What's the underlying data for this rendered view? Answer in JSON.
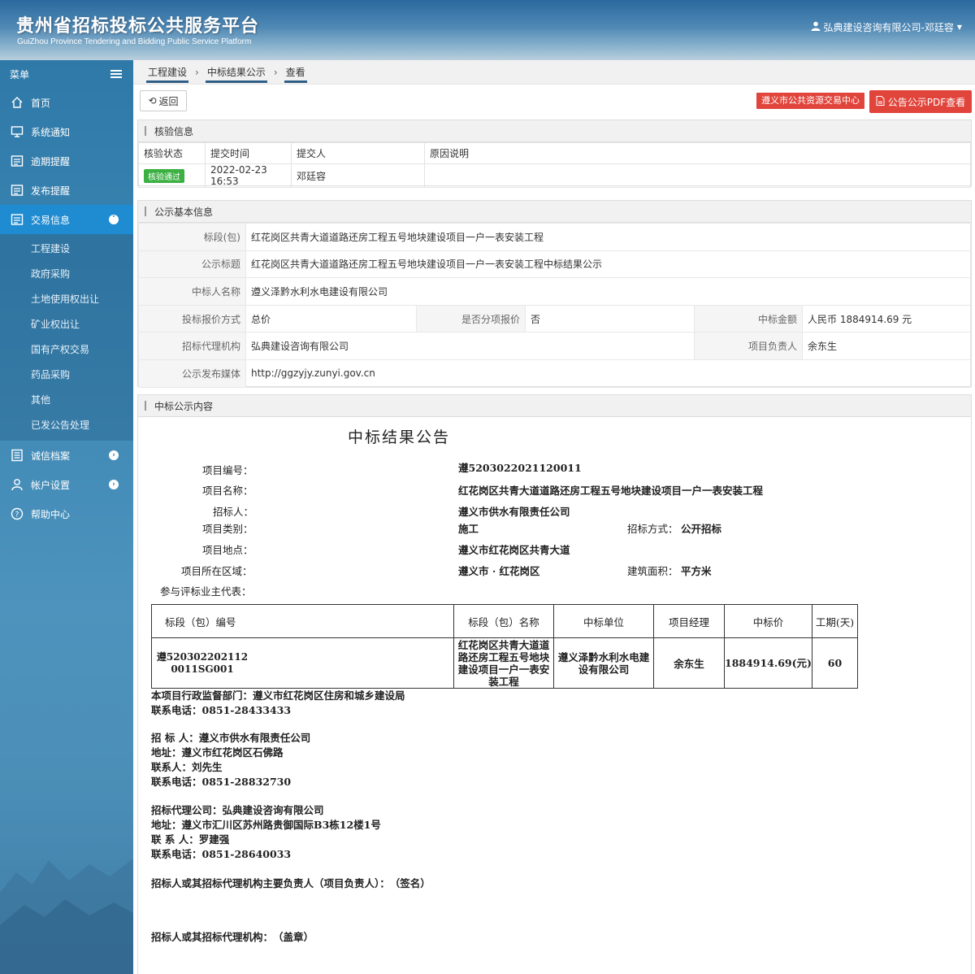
{
  "header": {
    "title": "贵州省招标投标公共服务平台",
    "subtitle": "GuiZhou Province Tendering and Bidding Public Service Platform",
    "user": "弘典建设咨询有限公司-邓廷容"
  },
  "sidebar": {
    "menu_label": "菜单",
    "items": [
      {
        "label": "首页",
        "icon": "home-icon"
      },
      {
        "label": "系统通知",
        "icon": "monitor-icon"
      },
      {
        "label": "逾期提醒",
        "icon": "list-icon"
      },
      {
        "label": "发布提醒",
        "icon": "list-icon"
      },
      {
        "label": "交易信息",
        "icon": "list-icon"
      }
    ],
    "sub_items": [
      "工程建设",
      "政府采购",
      "土地使用权出让",
      "矿业权出让",
      "国有产权交易",
      "药品采购",
      "其他",
      "已发公告处理"
    ],
    "bottom_items": [
      {
        "label": "诚信档案",
        "icon": "document-icon"
      },
      {
        "label": "帐户设置",
        "icon": "user-icon"
      },
      {
        "label": "帮助中心",
        "icon": "help-icon"
      }
    ]
  },
  "breadcrumb": [
    "工程建设",
    "中标结果公示",
    "查看"
  ],
  "toolbar": {
    "back": "返回",
    "center": "遵义市公共资源交易中心",
    "pdf": "公告公示PDF查看"
  },
  "verify": {
    "title": "核验信息",
    "headers": [
      "核验状态",
      "提交时间",
      "提交人",
      "原因说明"
    ],
    "row": {
      "status": "核验通过",
      "time": "2022-02-23 16:53",
      "person": "邓廷容",
      "reason": ""
    }
  },
  "basic": {
    "title": "公示基本信息",
    "section_label": "标段(包)",
    "section_value": "红花岗区共青大道道路还房工程五号地块建设项目一户一表安装工程",
    "notice_title_label": "公示标题",
    "notice_title_value": "红花岗区共青大道道路还房工程五号地块建设项目一户一表安装工程中标结果公示",
    "winner_label": "中标人名称",
    "winner_value": "遵义泽黔水利水电建设有限公司",
    "bid_method_label": "投标报价方式",
    "bid_method_value": "总价",
    "split_label": "是否分项报价",
    "split_value": "否",
    "amount_label": "中标金额",
    "amount_value": "人民币 1884914.69 元",
    "agency_label": "招标代理机构",
    "agency_value": "弘典建设咨询有限公司",
    "manager_label": "项目负责人",
    "manager_value": "余东生",
    "media_label": "公示发布媒体",
    "media_value": "http://ggzyjy.zunyi.gov.cn"
  },
  "content": {
    "title": "中标公示内容",
    "doc_title": "中标结果公告",
    "project_no_label": "项目编号：",
    "project_no": "遵5203022021120011",
    "project_name_label": "项目名称：",
    "project_name": "红花岗区共青大道道路还房工程五号地块建设项目一户一表安装工程",
    "tenderer_label": "招标人：",
    "tenderer": "遵义市供水有限责任公司",
    "category_label": "项目类别：",
    "category": "施工",
    "method_label": "招标方式：",
    "method": "公开招标",
    "location_label": "项目地点：",
    "location": "遵义市红花岗区共青大道",
    "region_label": "项目所在区域：",
    "region": "遵义市 · 红花岗区",
    "area_label": "建筑面积：",
    "area": "平方米",
    "rep_label": "参与评标业主代表：",
    "table_headers": [
      "标段（包）编号",
      "标段（包）名称",
      "中标单位",
      "项目经理",
      "中标价",
      "工期(天)"
    ],
    "table_row": {
      "code": "遵5203022021120011SG001",
      "name": "红花岗区共青大道道路还房工程五号地块建设项目一户一表安装工程",
      "unit": "遵义泽黔水利水电建设有限公司",
      "manager": "余东生",
      "price": "1884914.69(元)",
      "days": "60"
    },
    "supervise": "本项目行政监督部门：遵义市红花岗区住房和城乡建设局",
    "supervise_tel": "联系电话：0851-28433433",
    "tenderer_block": [
      "招 标 人：遵义市供水有限责任公司",
      "地址：遵义市红花岗区石佛路",
      "联系人：刘先生",
      "联系电话：0851-28832730"
    ],
    "agency_block": [
      "招标代理公司：弘典建设咨询有限公司",
      "地址：遵义市汇川区苏州路贵御国际B3栋12楼1号",
      "联 系 人：罗建强",
      "联系电话：0851-28640033"
    ],
    "sign1": "招标人或其招标代理机构主要负责人（项目负责人）：　（签名）",
    "sign2": "招标人或其招标代理机构：　（盖章）"
  },
  "colors": {
    "accent": "#1f8bd0",
    "danger": "#e1443b",
    "success": "#3cb043"
  }
}
